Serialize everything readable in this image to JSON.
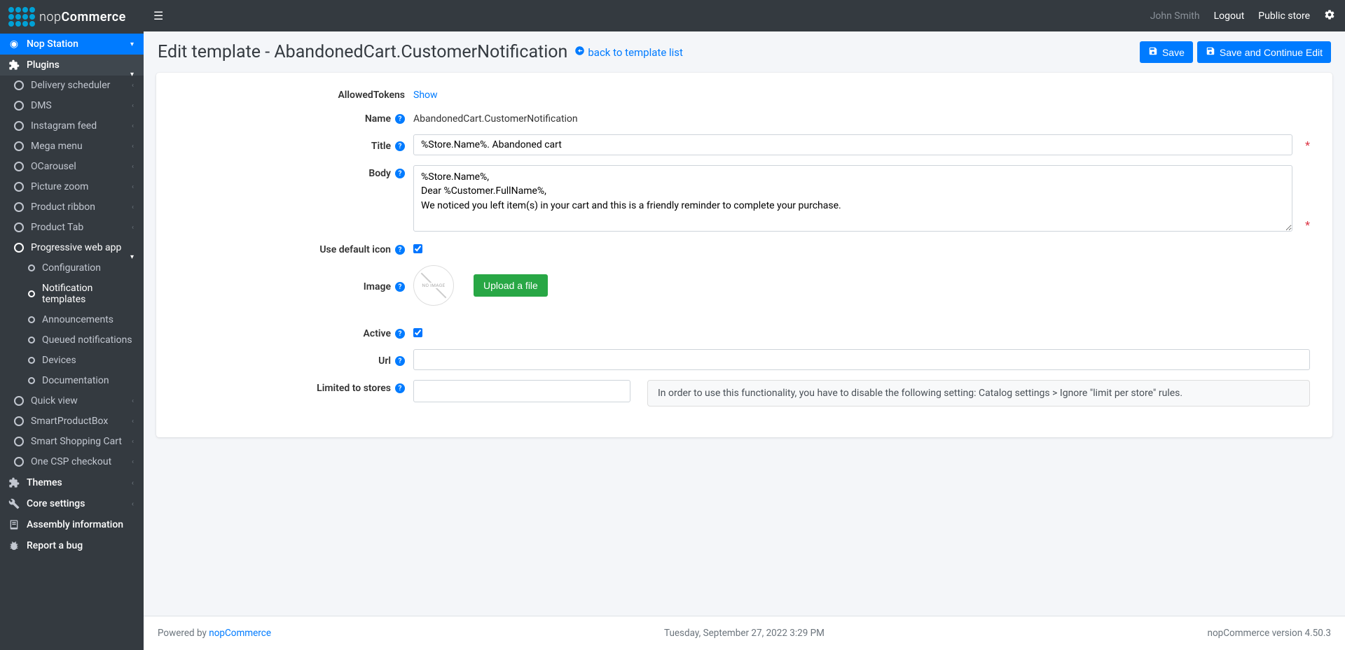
{
  "logo_text_light": "nop",
  "logo_text_bold": "Commerce",
  "topbar": {
    "user": "John Smith",
    "logout": "Logout",
    "public_store": "Public store"
  },
  "sidebar": {
    "nop_station": "Nop Station",
    "plugins": "Plugins",
    "items": [
      "Delivery scheduler",
      "DMS",
      "Instagram feed",
      "Mega menu",
      "OCarousel",
      "Picture zoom",
      "Product ribbon",
      "Product Tab"
    ],
    "pwa": "Progressive web app",
    "pwa_children": [
      "Configuration",
      "Notification templates",
      "Announcements",
      "Queued notifications",
      "Devices",
      "Documentation"
    ],
    "items_after": [
      "Quick view",
      "SmartProductBox",
      "Smart Shopping Cart",
      "One CSP checkout"
    ],
    "themes": "Themes",
    "core_settings": "Core settings",
    "assembly_info": "Assembly information",
    "report_bug": "Report a bug"
  },
  "header": {
    "title_prefix": "Edit template - ",
    "title_name": "AbandonedCart.CustomerNotification",
    "back_link": "back to template list",
    "save": "Save",
    "save_continue": "Save and Continue Edit"
  },
  "form": {
    "allowed_tokens_label": "AllowedTokens",
    "show": "Show",
    "name_label": "Name",
    "name_value": "AbandonedCart.CustomerNotification",
    "title_label": "Title",
    "title_value": "%Store.Name%. Abandoned cart",
    "body_label": "Body",
    "body_value": "%Store.Name%,\nDear %Customer.FullName%,\nWe noticed you left item(s) in your cart and this is a friendly reminder to complete your purchase.",
    "use_default_icon_label": "Use default icon",
    "use_default_icon_checked": true,
    "image_label": "Image",
    "no_image_text": "NO IMAGE",
    "upload_button": "Upload a file",
    "active_label": "Active",
    "active_checked": true,
    "url_label": "Url",
    "url_value": "",
    "limited_label": "Limited to stores",
    "limited_info": "In order to use this functionality, you have to disable the following setting: Catalog settings > Ignore \"limit per store\" rules."
  },
  "footer": {
    "powered_prefix": "Powered by ",
    "powered_link": "nopCommerce",
    "timestamp": "Tuesday, September 27, 2022 3:29 PM",
    "version": "nopCommerce version 4.50.3"
  }
}
